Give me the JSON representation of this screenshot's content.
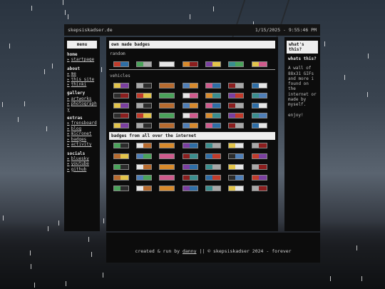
{
  "site": {
    "domain": "skepsiskadser.de",
    "datetime": "1/15/2025 - 9:55:46 PM"
  },
  "menu": {
    "title": "menu",
    "sections": [
      {
        "title": "home",
        "items": [
          "startpage"
        ]
      },
      {
        "title": "about",
        "items": [
          "me",
          "this site",
          "thinki"
        ]
      },
      {
        "title": "gallery",
        "items": [
          "artworks",
          "photography"
        ]
      },
      {
        "title": "extras",
        "items": [
          "frensboard",
          "blog",
          "micronet",
          "badges",
          "activity"
        ]
      },
      {
        "title": "socials",
        "items": [
          "bluesky",
          "youtube",
          "github"
        ]
      }
    ]
  },
  "main": {
    "title": "own made badges",
    "random_label": "random",
    "vehicles_label": "vehicles",
    "internet_title": "badges from all over the internet"
  },
  "side": {
    "title": "what's this?",
    "heading": "whats this?",
    "body": "A wall of 88x31 GIFs and more i found on the internet or made by myself.",
    "outro": "enjoy!"
  },
  "footer": {
    "prefix": "created & run by",
    "author": "danny",
    "suffix": "|| © skepsiskadser 2024 - forever"
  },
  "colors": {
    "window": "#0c0c0c",
    "panel_head": "#eeeeee",
    "text": "#cfcfcf"
  }
}
